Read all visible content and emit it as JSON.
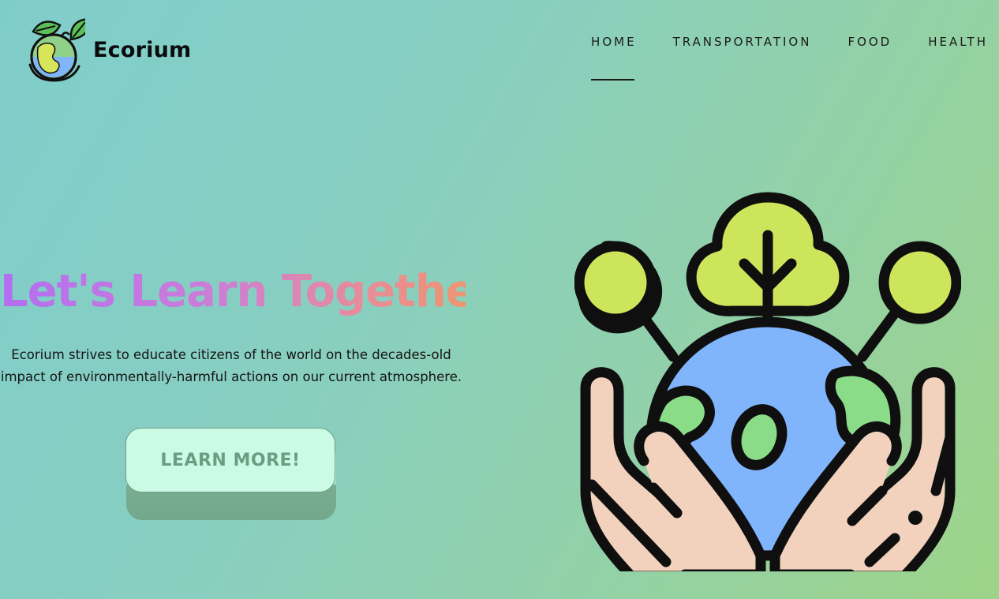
{
  "brand": {
    "name": "Ecorium",
    "logo_icon": "earth-leaves-icon"
  },
  "nav": {
    "items": [
      {
        "label": "HOME",
        "active": true
      },
      {
        "label": "TRANSPORTATION",
        "active": false
      },
      {
        "label": "FOOD",
        "active": false
      },
      {
        "label": "HEALTH",
        "active": false
      }
    ]
  },
  "hero": {
    "title": "Let's Learn Together!",
    "description": "Ecorium strives to educate citizens of the world on the decades-old impact of environmentally-harmful actions on our current atmosphere.",
    "cta_label": "LEARN MORE!",
    "illustration_icon": "hands-holding-earth-with-trees-icon"
  },
  "colors": {
    "background_start": "#7fcdcb",
    "background_end": "#9ed489",
    "title_gradient_start": "#b36ef2",
    "title_gradient_end": "#ef9470",
    "cta_fill": "#ccfbe5",
    "cta_text": "#6b9d82",
    "earth_blue": "#80b4fb",
    "land_green": "#8bdc88",
    "tree_green": "#cde55a",
    "hand_skin": "#f2d1bd"
  }
}
